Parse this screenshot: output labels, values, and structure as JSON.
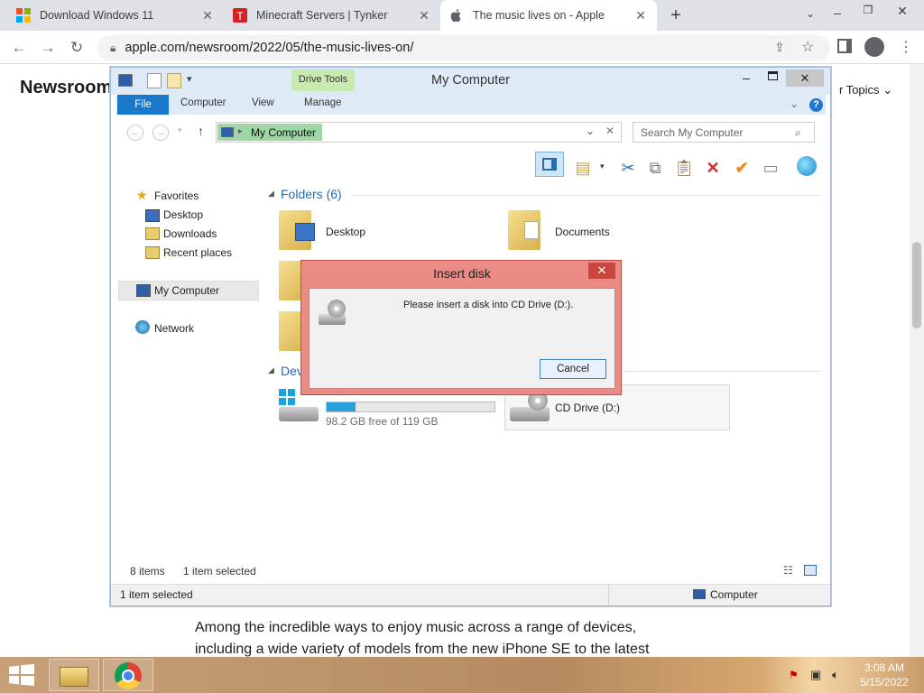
{
  "browser": {
    "tabs": [
      {
        "title": "Download Windows 11",
        "favicon": "windows-logo-icon"
      },
      {
        "title": "Minecraft Servers | Tynker",
        "favicon": "tynker-logo-icon"
      },
      {
        "title": "The music lives on - Apple",
        "favicon": "apple-logo-icon"
      }
    ],
    "url": "apple.com/newsroom/2022/05/the-music-lives-on/",
    "new_tab": "+",
    "colors": {
      "tabbar": "#dee1e6",
      "omnibox": "#f1f3f4"
    }
  },
  "page": {
    "newsroom": "Newsroom",
    "topics": "r Topics",
    "text_line1": "Among the incredible ways to enjoy music across a range of devices,",
    "text_line2": "including a wide variety of models from the new iPhone SE to the latest"
  },
  "explorer": {
    "title": "My Computer",
    "contextual_tab": "Drive Tools",
    "ribbon_tabs": {
      "file": "File",
      "computer": "Computer",
      "view": "View",
      "manage": "Manage"
    },
    "address": "My Computer",
    "search_placeholder": "Search My Computer",
    "nav": {
      "favorites": "Favorites",
      "desktop": "Desktop",
      "downloads": "Downloads",
      "recent": "Recent places",
      "my_computer": "My Computer",
      "network": "Network"
    },
    "folders_header": "Folders (6)",
    "folders": {
      "desktop": "Desktop",
      "documents": "Documents"
    },
    "devices_header": "Dev",
    "drive_c": {
      "free": "98.2 GB free of 119 GB",
      "used_fraction": 0.17
    },
    "drive_d": {
      "label": "CD Drive (D:)"
    },
    "status": {
      "items": "8 items",
      "selected": "1 item selected"
    },
    "details": {
      "selected": "1 item selected",
      "location": "Computer"
    }
  },
  "dialog": {
    "title": "Insert disk",
    "close": "✕",
    "message": "Please insert a disk into CD Drive (D:).",
    "cancel": "Cancel"
  },
  "taskbar": {
    "time": "3:08 AM",
    "date": "5/15/2022"
  }
}
